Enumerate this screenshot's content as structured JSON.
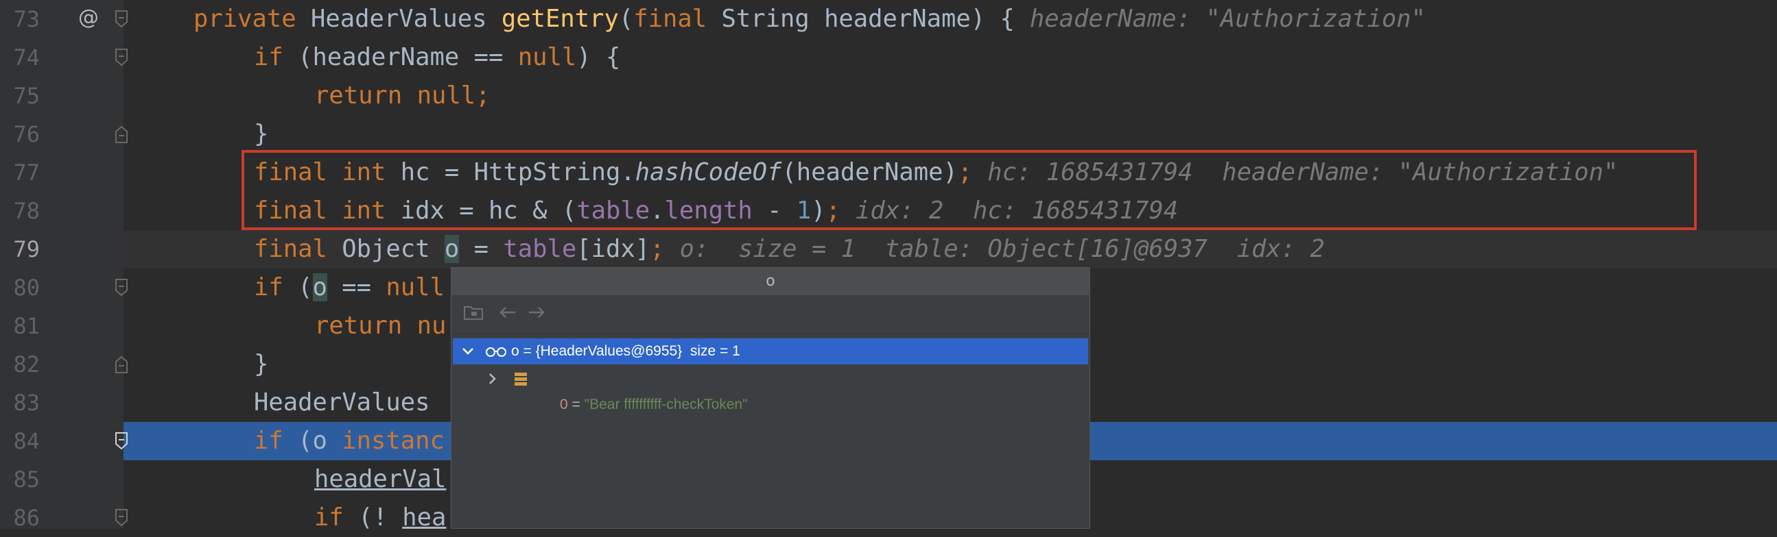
{
  "editor": {
    "lines": [
      {
        "num": "73",
        "tokens": [
          {
            "t": "private ",
            "c": "kw"
          },
          {
            "t": "HeaderValues ",
            "c": ""
          },
          {
            "t": "getEntry",
            "c": "fn"
          },
          {
            "t": "(",
            "c": ""
          },
          {
            "t": "final ",
            "c": "kw"
          },
          {
            "t": "String headerName) {",
            "c": ""
          }
        ],
        "hint": "headerName: \"Authorization\""
      },
      {
        "num": "74",
        "tokens": [
          {
            "t": "if ",
            "c": "kw"
          },
          {
            "t": "(headerName == ",
            "c": ""
          },
          {
            "t": "null",
            "c": "kw"
          },
          {
            "t": ") {",
            "c": ""
          }
        ]
      },
      {
        "num": "75",
        "tokens": [
          {
            "t": "return null;",
            "c": "kw"
          }
        ]
      },
      {
        "num": "76",
        "tokens": [
          {
            "t": "}",
            "c": ""
          }
        ]
      },
      {
        "num": "77",
        "tokens": [
          {
            "t": "final int ",
            "c": "kw"
          },
          {
            "t": "hc = HttpString.",
            "c": ""
          },
          {
            "t": "hashCodeOf",
            "c": "it"
          },
          {
            "t": "(headerName)",
            "c": ""
          },
          {
            "t": ";",
            "c": "kw"
          }
        ],
        "hint": "hc: 1685431794  headerName: \"Authorization\""
      },
      {
        "num": "78",
        "tokens": [
          {
            "t": "final int ",
            "c": "kw"
          },
          {
            "t": "idx = hc & (",
            "c": ""
          },
          {
            "t": "table",
            "c": "fld"
          },
          {
            "t": ".",
            "c": ""
          },
          {
            "t": "length",
            "c": "fld"
          },
          {
            "t": " - ",
            "c": ""
          },
          {
            "t": "1",
            "c": "num"
          },
          {
            "t": ")",
            "c": ""
          },
          {
            "t": ";",
            "c": "kw"
          }
        ],
        "hint": "idx: 2  hc: 1685431794"
      },
      {
        "num": "79",
        "tokens": [
          {
            "t": "final ",
            "c": "kw"
          },
          {
            "t": "Object ",
            "c": ""
          },
          {
            "t": "o",
            "c": "hl-var"
          },
          {
            "t": " = ",
            "c": ""
          },
          {
            "t": "table",
            "c": "fld"
          },
          {
            "t": "[idx]",
            "c": ""
          },
          {
            "t": ";",
            "c": "kw"
          }
        ],
        "hint": "o:  size = 1  table: Object[16]@6937  idx: 2"
      },
      {
        "num": "80",
        "tokens": [
          {
            "t": "if ",
            "c": "kw"
          },
          {
            "t": "(",
            "c": ""
          },
          {
            "t": "o",
            "c": "hl-var"
          },
          {
            "t": " == ",
            "c": ""
          },
          {
            "t": "null",
            "c": "kw"
          }
        ]
      },
      {
        "num": "81",
        "tokens": [
          {
            "t": "return nu",
            "c": "kw"
          }
        ]
      },
      {
        "num": "82",
        "tokens": [
          {
            "t": "}",
            "c": ""
          }
        ]
      },
      {
        "num": "83",
        "tokens": [
          {
            "t": "HeaderValues",
            "c": ""
          }
        ]
      },
      {
        "num": "84",
        "tokens": [
          {
            "t": "if ",
            "c": "kw"
          },
          {
            "t": "(o ",
            "c": ""
          },
          {
            "t": "instanc",
            "c": "kw"
          }
        ]
      },
      {
        "num": "85",
        "tokens": [
          {
            "t": "headerVal",
            "c": "ul"
          }
        ]
      },
      {
        "num": "86",
        "tokens": [
          {
            "t": "if ",
            "c": "kw"
          },
          {
            "t": "(! ",
            "c": ""
          },
          {
            "t": "hea",
            "c": "ul"
          }
        ]
      }
    ]
  },
  "popup": {
    "title": "o",
    "rows": [
      {
        "label": "o = {HeaderValues@6955}  size = 1"
      },
      {
        "index": "0",
        "eq": " = ",
        "value": "\"Bear ffffffffff-checkToken\""
      }
    ]
  },
  "colors": {
    "highlight_box": "#c93c2c",
    "exec_line": "#2d5d9f",
    "selected_row": "#2f65ca"
  }
}
